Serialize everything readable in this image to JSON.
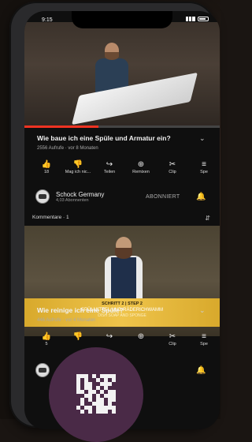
{
  "status": {
    "time": "9:15"
  },
  "video1": {
    "title": "Wie baue ich eine Spüle und Armatur ein?",
    "meta": "2556 Aufrufe · vor 8 Monaten",
    "actions": [
      {
        "icon": "thumb-up-icon",
        "glyph": "👍",
        "label": "18"
      },
      {
        "icon": "thumb-down-icon",
        "glyph": "👎",
        "label": "Mag ich nic..."
      },
      {
        "icon": "share-icon",
        "glyph": "↪",
        "label": "Teilen"
      },
      {
        "icon": "remix-icon",
        "glyph": "⊕",
        "label": "Remixen"
      },
      {
        "icon": "clip-icon",
        "glyph": "✂",
        "label": "Clip"
      },
      {
        "icon": "save-icon",
        "glyph": "≡",
        "label": "Spe"
      }
    ]
  },
  "channel": {
    "name": "Schock Germany",
    "subs": "4,03 Abonnenten",
    "subscribe": "ABONNIERT"
  },
  "comments": {
    "label": "Kommentare · 1"
  },
  "video2": {
    "banner_line1": "SCHRITT 2 | STEP 2",
    "banner_line2": "SPÜLMITTEL UND RÄDERICHWAMM",
    "banner_line3": "DISH SOAP AND SPONGE",
    "title": "Wie reinige ich eine Spüle?",
    "meta": "446 Aufrufe · vor 4 Monaten",
    "actions": [
      {
        "icon": "thumb-up-icon",
        "glyph": "👍",
        "label": "5"
      },
      {
        "icon": "thumb-down-icon",
        "glyph": "👎",
        "label": ""
      },
      {
        "icon": "share-icon",
        "glyph": "↪",
        "label": ""
      },
      {
        "icon": "remix-icon",
        "glyph": "⊕",
        "label": ""
      },
      {
        "icon": "clip-icon",
        "glyph": "✂",
        "label": "Clip"
      },
      {
        "icon": "save-icon",
        "glyph": "≡",
        "label": "Spe"
      }
    ]
  },
  "colors": {
    "progress": "#ee3322",
    "badge": "#4a2a47",
    "banner": "#efc44b"
  }
}
